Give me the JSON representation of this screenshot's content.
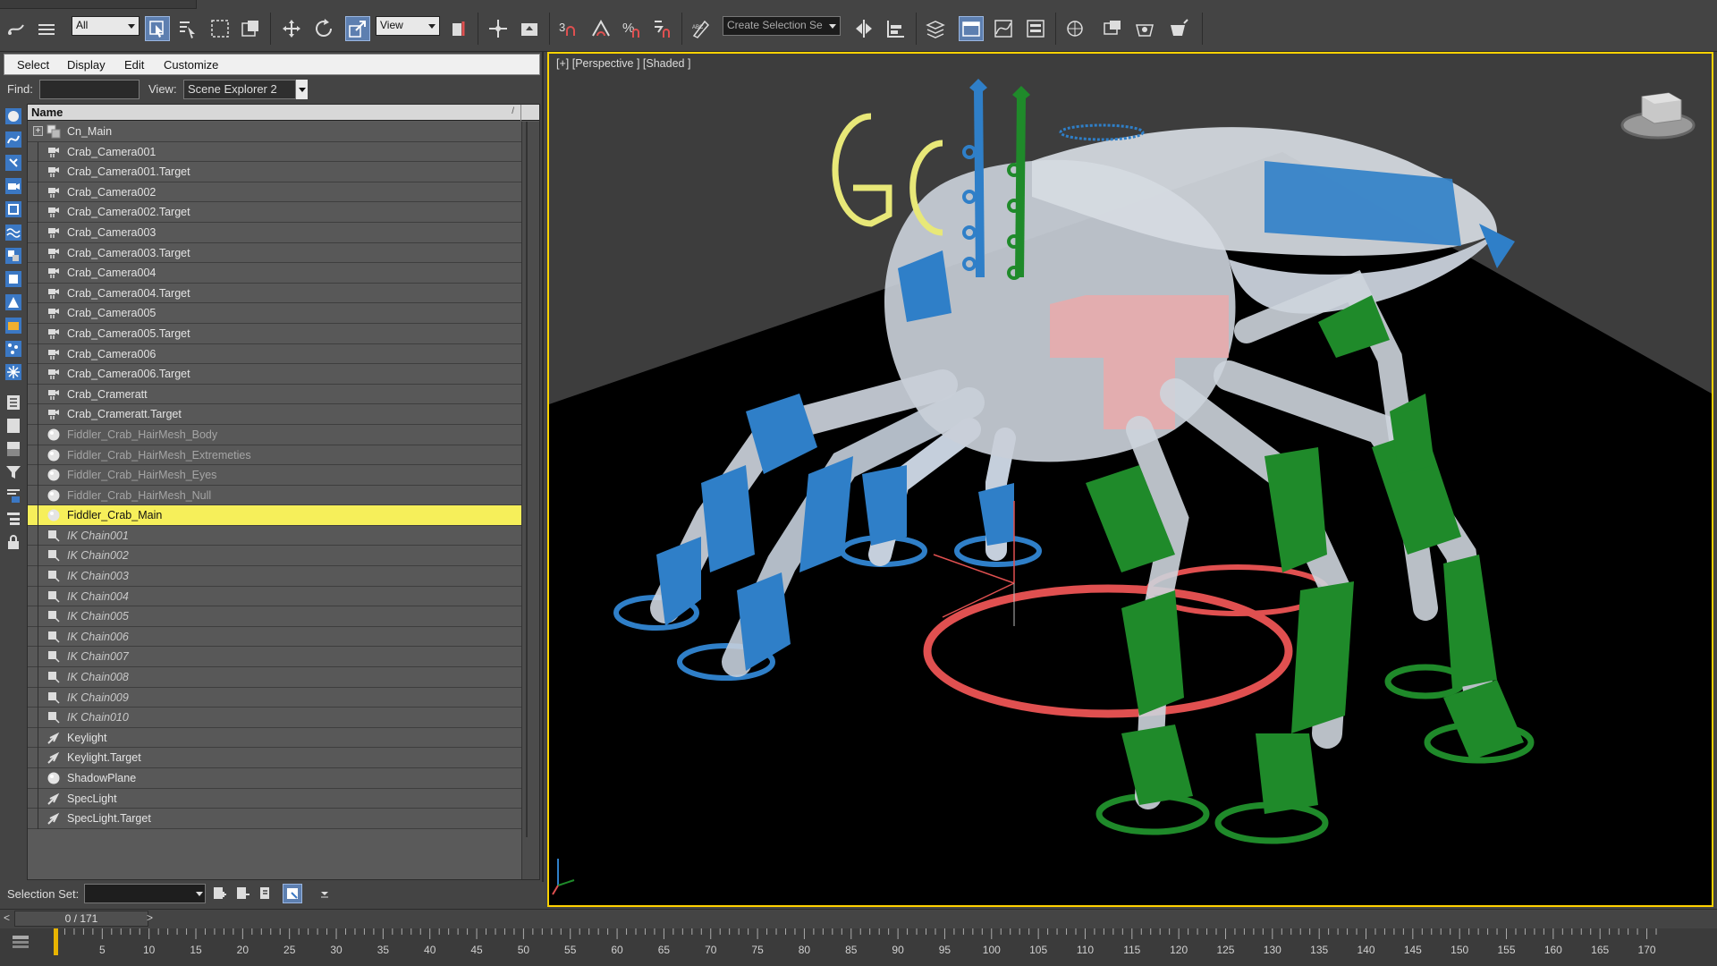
{
  "toolbar": {
    "filter_select": "All",
    "ref_coord_select": "View",
    "named_selection_select": "Create Selection Se"
  },
  "explorer": {
    "menu": [
      "Select",
      "Display",
      "Edit",
      "Customize"
    ],
    "find_label": "Find:",
    "find_value": "",
    "view_label": "View:",
    "view_value": "Scene Explorer 2",
    "column_header": "Name",
    "selection_set_label": "Selection Set:",
    "rows": [
      {
        "label": "Cn_Main",
        "icon": "group-icon",
        "style": "normal",
        "expand": "+"
      },
      {
        "label": "Crab_Camera001",
        "icon": "camera-icon",
        "style": "normal"
      },
      {
        "label": "Crab_Camera001.Target",
        "icon": "camera-icon",
        "style": "normal"
      },
      {
        "label": "Crab_Camera002",
        "icon": "camera-icon",
        "style": "normal"
      },
      {
        "label": "Crab_Camera002.Target",
        "icon": "camera-icon",
        "style": "normal"
      },
      {
        "label": "Crab_Camera003",
        "icon": "camera-icon",
        "style": "normal"
      },
      {
        "label": "Crab_Camera003.Target",
        "icon": "camera-icon",
        "style": "normal"
      },
      {
        "label": "Crab_Camera004",
        "icon": "camera-icon",
        "style": "normal"
      },
      {
        "label": "Crab_Camera004.Target",
        "icon": "camera-icon",
        "style": "normal"
      },
      {
        "label": "Crab_Camera005",
        "icon": "camera-icon",
        "style": "normal"
      },
      {
        "label": "Crab_Camera005.Target",
        "icon": "camera-icon",
        "style": "normal"
      },
      {
        "label": "Crab_Camera006",
        "icon": "camera-icon",
        "style": "normal"
      },
      {
        "label": "Crab_Camera006.Target",
        "icon": "camera-icon",
        "style": "normal"
      },
      {
        "label": "Crab_Crameratt",
        "icon": "camera-icon",
        "style": "normal"
      },
      {
        "label": "Crab_Crameratt.Target",
        "icon": "camera-icon",
        "style": "normal"
      },
      {
        "label": "Fiddler_Crab_HairMesh_Body",
        "icon": "geometry-icon",
        "style": "dim"
      },
      {
        "label": "Fiddler_Crab_HairMesh_Extremeties",
        "icon": "geometry-icon",
        "style": "dim"
      },
      {
        "label": "Fiddler_Crab_HairMesh_Eyes",
        "icon": "geometry-icon",
        "style": "dim"
      },
      {
        "label": "Fiddler_Crab_HairMesh_Null",
        "icon": "geometry-icon",
        "style": "dim"
      },
      {
        "label": "Fiddler_Crab_Main",
        "icon": "geometry-icon",
        "style": "selected"
      },
      {
        "label": "IK Chain001",
        "icon": "ik-chain-icon",
        "style": "italic"
      },
      {
        "label": "IK Chain002",
        "icon": "ik-chain-icon",
        "style": "italic"
      },
      {
        "label": "IK Chain003",
        "icon": "ik-chain-icon",
        "style": "italic"
      },
      {
        "label": "IK Chain004",
        "icon": "ik-chain-icon",
        "style": "italic"
      },
      {
        "label": "IK Chain005",
        "icon": "ik-chain-icon",
        "style": "italic"
      },
      {
        "label": "IK Chain006",
        "icon": "ik-chain-icon",
        "style": "italic"
      },
      {
        "label": "IK Chain007",
        "icon": "ik-chain-icon",
        "style": "italic"
      },
      {
        "label": "IK Chain008",
        "icon": "ik-chain-icon",
        "style": "italic"
      },
      {
        "label": "IK Chain009",
        "icon": "ik-chain-icon",
        "style": "italic"
      },
      {
        "label": "IK Chain010",
        "icon": "ik-chain-icon",
        "style": "italic"
      },
      {
        "label": "Keylight",
        "icon": "light-icon",
        "style": "normal"
      },
      {
        "label": "Keylight.Target",
        "icon": "light-icon",
        "style": "normal"
      },
      {
        "label": "ShadowPlane",
        "icon": "geometry-icon",
        "style": "normal"
      },
      {
        "label": "SpecLight",
        "icon": "light-icon",
        "style": "normal"
      },
      {
        "label": "SpecLight.Target",
        "icon": "light-icon",
        "style": "normal"
      }
    ]
  },
  "viewport": {
    "label": "[+] [Perspective ] [Shaded ]"
  },
  "timeline": {
    "frame_display": "0 / 171",
    "prev_label": "<",
    "next_label": ">",
    "ticks": [
      "5",
      "10",
      "15",
      "20",
      "25",
      "30",
      "35",
      "40",
      "45",
      "50",
      "55",
      "60",
      "65",
      "70",
      "75",
      "80",
      "85",
      "90",
      "95",
      "100",
      "105",
      "110",
      "115",
      "120",
      "125",
      "130",
      "135",
      "140",
      "145",
      "150",
      "155",
      "160",
      "165",
      "170"
    ],
    "start_frame": "0"
  },
  "colors": {
    "selection_highlight": "#f6ef5a",
    "viewport_border": "#ffd200",
    "active_button": "#5d7fb0",
    "rig_blue": "#2f7fc8",
    "rig_green": "#1f8a2a",
    "rig_red": "#e05050",
    "rig_yellow": "#e8e878"
  }
}
